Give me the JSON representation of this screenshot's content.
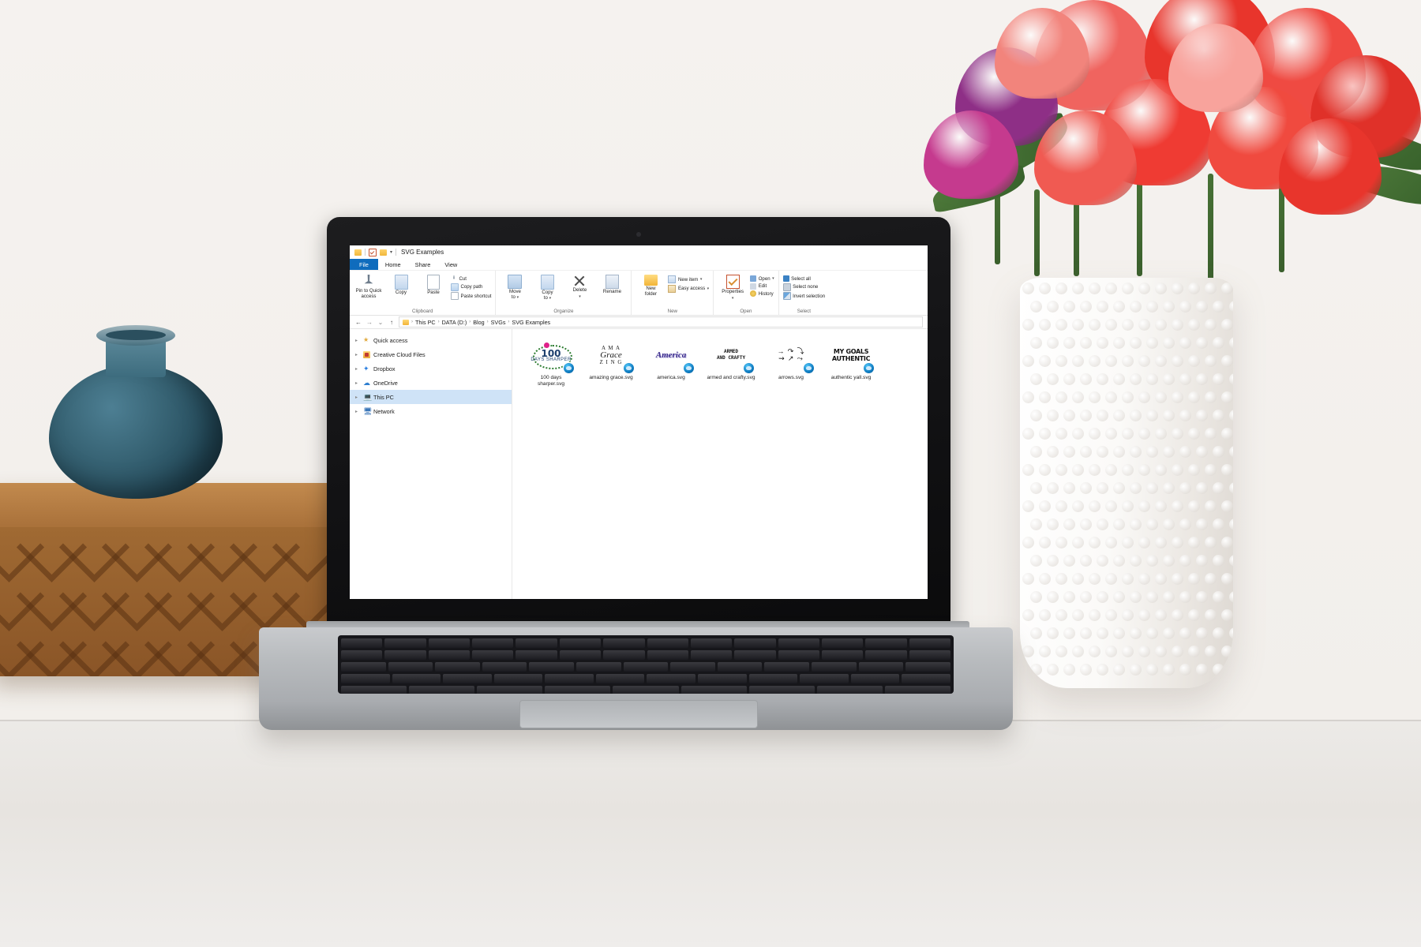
{
  "scene": {
    "description": "Photograph of a laptop on a white desk showing Windows File Explorer, with red tulips in a white vase, a blue ceramic vase and a carved wooden box"
  },
  "explorer": {
    "title": "SVG Examples",
    "quick_access_icons": [
      "folder-icon",
      "properties-icon",
      "folder-icon",
      "customize-chevron-icon"
    ],
    "tabs": [
      {
        "label": "File",
        "active": false,
        "is_file_menu": true
      },
      {
        "label": "Home",
        "active": true,
        "is_file_menu": false
      },
      {
        "label": "Share",
        "active": false,
        "is_file_menu": false
      },
      {
        "label": "View",
        "active": false,
        "is_file_menu": false
      }
    ],
    "ribbon": {
      "groups": [
        {
          "name": "Clipboard",
          "big_buttons": [
            {
              "label": "Pin to Quick\naccess",
              "icon": "pin-icon"
            },
            {
              "label": "Copy",
              "icon": "copy-icon"
            },
            {
              "label": "Paste",
              "icon": "paste-icon"
            }
          ],
          "small_buttons": [
            {
              "label": "Cut",
              "icon": "cut-icon"
            },
            {
              "label": "Copy path",
              "icon": "copy-path-icon"
            },
            {
              "label": "Paste shortcut",
              "icon": "paste-shortcut-icon"
            }
          ]
        },
        {
          "name": "Organize",
          "big_buttons": [
            {
              "label": "Move\nto",
              "icon": "move-to-icon",
              "dropdown": true
            },
            {
              "label": "Copy\nto",
              "icon": "copy-to-icon",
              "dropdown": true
            },
            {
              "label": "Delete",
              "icon": "delete-icon",
              "dropdown": true
            },
            {
              "label": "Rename",
              "icon": "rename-icon"
            }
          ],
          "small_buttons": []
        },
        {
          "name": "New",
          "big_buttons": [
            {
              "label": "New\nfolder",
              "icon": "new-folder-icon"
            }
          ],
          "small_buttons": [
            {
              "label": "New item",
              "icon": "new-item-icon",
              "dropdown": true
            },
            {
              "label": "Easy access",
              "icon": "easy-access-icon",
              "dropdown": true
            }
          ]
        },
        {
          "name": "Open",
          "big_buttons": [
            {
              "label": "Properties",
              "icon": "properties-icon",
              "dropdown": true
            }
          ],
          "small_buttons": [
            {
              "label": "Open",
              "icon": "open-icon",
              "dropdown": true
            },
            {
              "label": "Edit",
              "icon": "edit-icon"
            },
            {
              "label": "History",
              "icon": "history-icon"
            }
          ]
        },
        {
          "name": "Select",
          "big_buttons": [],
          "small_buttons": [
            {
              "label": "Select all",
              "icon": "select-all-icon"
            },
            {
              "label": "Select none",
              "icon": "select-none-icon"
            },
            {
              "label": "Invert selection",
              "icon": "invert-selection-icon"
            }
          ]
        }
      ]
    },
    "address_bar": {
      "back": "←",
      "forward": "→",
      "recent": "⌄",
      "up": "↑",
      "breadcrumbs": [
        "This PC",
        "DATA (D:)",
        "Blog",
        "SVGs",
        "SVG Examples"
      ],
      "separator": "›"
    },
    "navigation_pane": [
      {
        "label": "Quick access",
        "icon": "star-icon",
        "selected": false
      },
      {
        "label": "Creative Cloud Files",
        "icon": "creative-cloud-icon",
        "selected": false
      },
      {
        "label": "Dropbox",
        "icon": "dropbox-icon",
        "selected": false
      },
      {
        "label": "OneDrive",
        "icon": "onedrive-cloud-icon",
        "selected": false
      },
      {
        "label": "This PC",
        "icon": "this-pc-icon",
        "selected": true
      },
      {
        "label": "Network",
        "icon": "network-icon",
        "selected": false
      }
    ],
    "files": [
      {
        "name": "100 days sharper.svg",
        "art_kind": "hundred-days",
        "art_text": [
          "100",
          "DAYS SHARPER"
        ]
      },
      {
        "name": "amazing grace.svg",
        "art_kind": "amazing-grace",
        "art_text": [
          "A M A",
          "Grace",
          "Z I N G"
        ]
      },
      {
        "name": "america.svg",
        "art_kind": "america",
        "art_text": [
          "America"
        ]
      },
      {
        "name": "armed and crafty.svg",
        "art_kind": "armed-crafty",
        "art_text": [
          "ARMED",
          "AND CRAFTY"
        ]
      },
      {
        "name": "arrows.svg",
        "art_kind": "arrows",
        "art_text": [
          "→ ↷ ⤵",
          "⇝ ↗ ⤳"
        ]
      },
      {
        "name": "authentic yall.svg",
        "art_kind": "authentic-yall",
        "art_text": [
          "MY GOALS",
          "AUTHENTIC"
        ]
      }
    ]
  },
  "colors": {
    "file_tab_blue": "#0f6cbd",
    "selection_blue": "#cfe3f7",
    "window_bg": "#ffffff",
    "tulip_red": "#e8352c",
    "tulip_pink": "#f0645f",
    "tulip_purple": "#8e2f86",
    "vase_blue": "#36637 4",
    "wood_brown": "#8a5527"
  }
}
